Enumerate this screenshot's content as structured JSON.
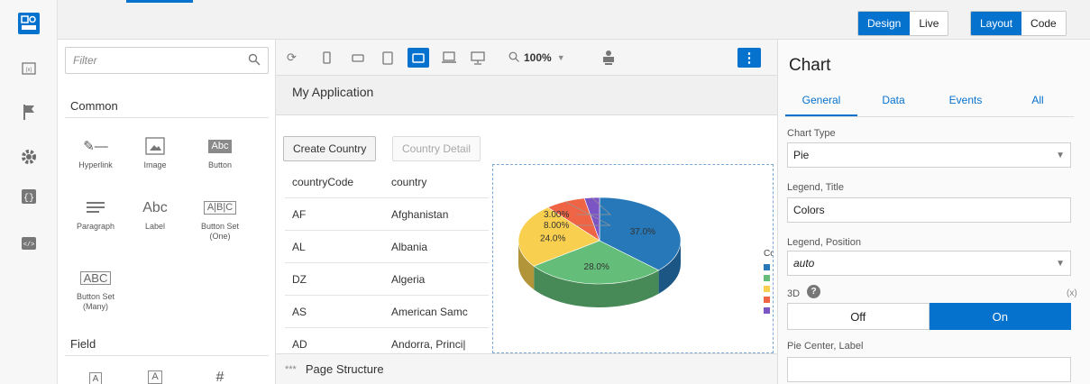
{
  "topbar": {
    "design": "Design",
    "live": "Live",
    "layout": "Layout",
    "code": "Code",
    "accent": "#0572ce"
  },
  "rail": {
    "icons": [
      "components-icon",
      "variables-icon",
      "flag-icon",
      "gear-icon",
      "json-icon",
      "source-icon"
    ]
  },
  "palette": {
    "filter_placeholder": "Filter",
    "section_common": "Common",
    "section_field": "Field",
    "items": [
      {
        "label": "Hyperlink",
        "glyph": "✐—"
      },
      {
        "label": "Image",
        "glyph": "▣"
      },
      {
        "label": "Button",
        "glyph": "Abc"
      },
      {
        "label": "Paragraph",
        "glyph": "≡"
      },
      {
        "label": "Label",
        "glyph": "Abc"
      },
      {
        "label": "Button Set\n(One)",
        "glyph": "A|B|C"
      },
      {
        "label": "Button Set\n(Many)",
        "glyph": "ABC"
      }
    ],
    "field_glyphs": [
      "A",
      "A",
      "#"
    ]
  },
  "canvas": {
    "zoom": "100%",
    "app_title": "My Application",
    "create_btn": "Create Country",
    "detail_btn": "Country Detail",
    "columns": [
      "countryCode",
      "country"
    ],
    "rows": [
      [
        "AF",
        "Afghanistan"
      ],
      [
        "AL",
        "Albania"
      ],
      [
        "DZ",
        "Algeria"
      ],
      [
        "AS",
        "American Samc"
      ],
      [
        "AD",
        "Andorra, Princi|"
      ]
    ],
    "page_structure": "Page Structure",
    "dots": "***"
  },
  "chart_data": {
    "type": "pie",
    "three_d": true,
    "slices": [
      {
        "label": "37.0%",
        "value": 37.0,
        "color": "#2778b8"
      },
      {
        "label": "28.0%",
        "value": 28.0,
        "color": "#64be7a"
      },
      {
        "label": "24.0%",
        "value": 24.0,
        "color": "#f8cf4f"
      },
      {
        "label": "8.00%",
        "value": 8.0,
        "color": "#ef6444"
      },
      {
        "label": "3.00%",
        "value": 3.0,
        "color": "#7c55c4"
      }
    ],
    "legend_title_partial": "Co",
    "legend_swatch_colors": [
      "#2778b8",
      "#64be7a",
      "#f8cf4f",
      "#ef6444",
      "#7c55c4"
    ]
  },
  "props": {
    "title": "Chart",
    "tabs": [
      "General",
      "Data",
      "Events",
      "All"
    ],
    "chart_type_label": "Chart Type",
    "chart_type_value": "Pie",
    "legend_title_label": "Legend, Title",
    "legend_title_value": "Colors",
    "legend_position_label": "Legend, Position",
    "legend_position_value": "auto",
    "three_d_label": "3D",
    "var_hint": "(x)",
    "off": "Off",
    "on": "On",
    "pie_center_label": "Pie Center, Label"
  }
}
